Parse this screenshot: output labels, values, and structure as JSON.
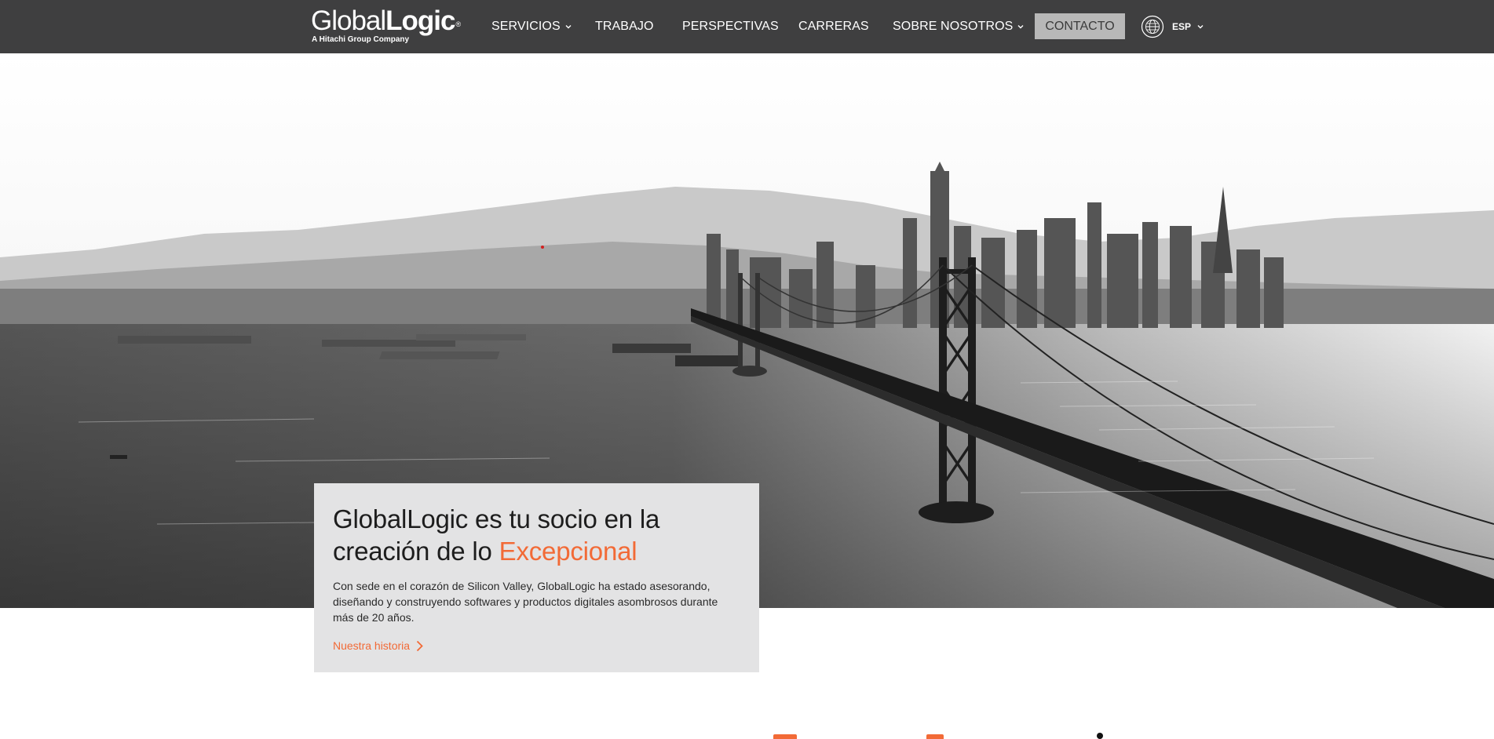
{
  "brand": {
    "logo_light": "Global",
    "logo_bold": "Logic",
    "logo_mark": "®",
    "tagline": "A Hitachi Group Company"
  },
  "nav": {
    "items": [
      {
        "label": "SERVICIOS",
        "dropdown": true
      },
      {
        "label": "TRABAJO",
        "dropdown": false
      },
      {
        "label": "PERSPECTIVAS",
        "dropdown": false
      },
      {
        "label": "CARRERAS",
        "dropdown": false
      },
      {
        "label": "SOBRE NOSOTROS",
        "dropdown": true
      }
    ],
    "contact_label": "CONTACTO",
    "language": "ESP",
    "language_icon": "globe-icon"
  },
  "hero": {
    "image_description_icon": "bridge-city-photo",
    "heading_prefix": "GlobalLogic es tu socio en la creación de lo ",
    "heading_accent": "Excepcional",
    "body": "Con sede en el corazón de Silicon Valley, GlobalLogic ha estado asesorando, diseñando y construyendo softwares y productos digitales asombrosos durante más de 20 años.",
    "cta_label": "Nuestra historia"
  },
  "colors": {
    "nav_bg": "#3f3f40",
    "accent": "#f26a36",
    "card_bg": "#e3e3e4",
    "contact_bg": "#b8b8b8"
  }
}
